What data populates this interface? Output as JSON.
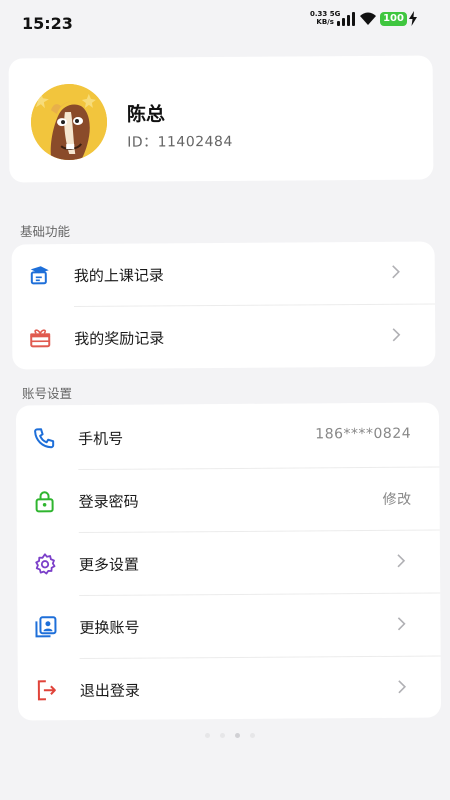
{
  "status_bar": {
    "time": "15:23",
    "net_speed_value": "0.33 5G",
    "net_speed_unit": "KB/s",
    "battery": "100",
    "battery_color": "#3fc63f"
  },
  "profile": {
    "name": "陈总",
    "id_text": "ID：11402484",
    "avatar_icon": "horse-cartoon-avatar"
  },
  "basic": {
    "title": "基础功能",
    "items": [
      {
        "label": "我的上课记录",
        "icon": "class-record-icon",
        "color": "#1e6fd9"
      },
      {
        "label": "我的奖励记录",
        "icon": "gift-icon",
        "color": "#e05a4f"
      }
    ]
  },
  "account": {
    "title": "账号设置",
    "items": [
      {
        "label": "手机号",
        "value": "186****0824",
        "icon": "phone-icon",
        "color": "#1e6fd9"
      },
      {
        "label": "登录密码",
        "value": "修改",
        "icon": "lock-icon",
        "color": "#2fb52f"
      },
      {
        "label": "更多设置",
        "icon": "gear-icon",
        "color": "#7b3fc9"
      },
      {
        "label": "更换账号",
        "icon": "switch-account-icon",
        "color": "#1e6fd9"
      },
      {
        "label": "退出登录",
        "icon": "logout-icon",
        "color": "#e0433a"
      }
    ]
  }
}
